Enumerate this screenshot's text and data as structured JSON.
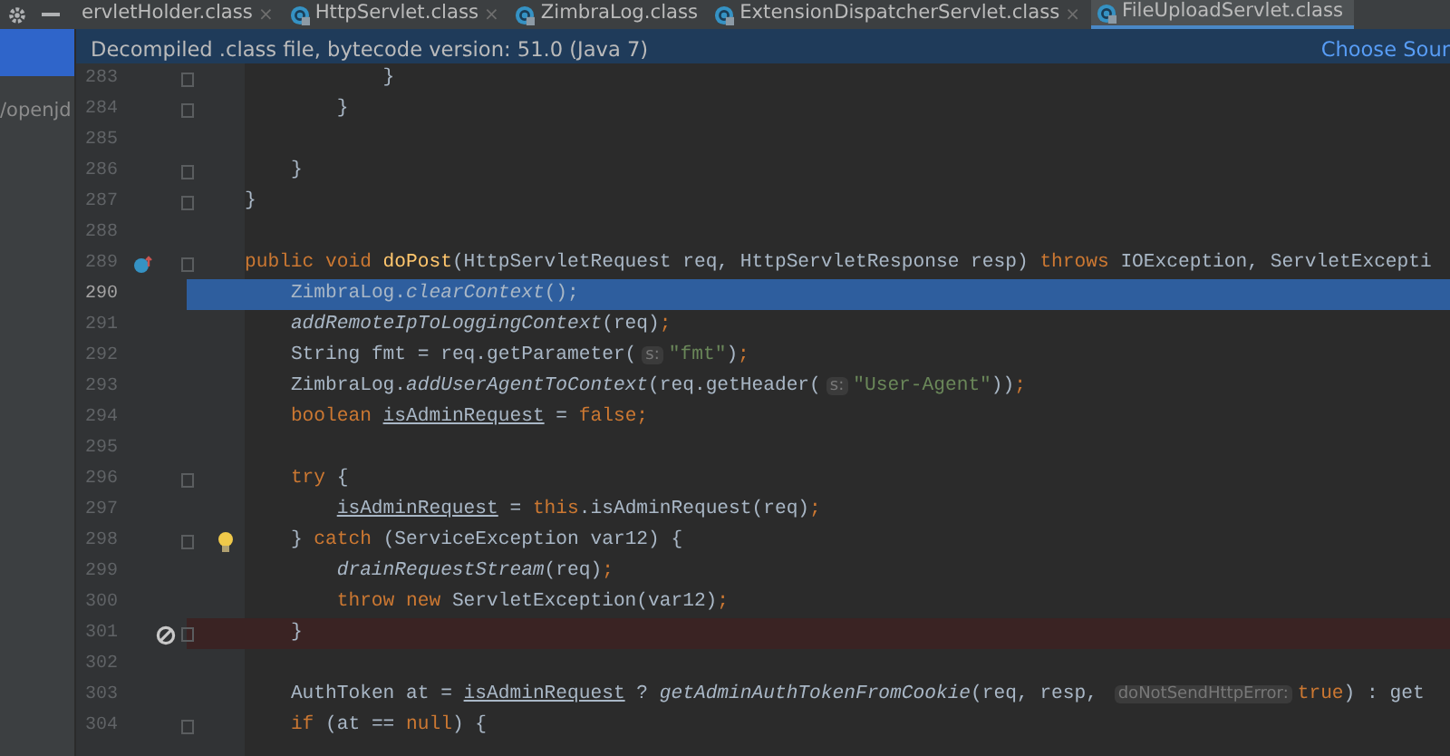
{
  "toolbar": {
    "sidebar_label": "/openjd"
  },
  "tabs": [
    {
      "label": "ervletHolder.class",
      "selected": false,
      "close": "×",
      "icon": false
    },
    {
      "label": "HttpServlet.class",
      "selected": false,
      "close": "×",
      "icon": true
    },
    {
      "label": "ZimbraLog.class",
      "selected": false,
      "icon": true
    },
    {
      "label": "ExtensionDispatcherServlet.class",
      "selected": false,
      "close": "×",
      "icon": true
    },
    {
      "label": "FileUploadServlet.class",
      "selected": true,
      "icon": true
    }
  ],
  "banner": {
    "message": "Decompiled .class file, bytecode version: 51.0 (Java 7)",
    "link": "Choose Sour"
  },
  "lines": [
    {
      "number": "283",
      "selected": false,
      "breakpoint": false,
      "foldable": true,
      "segments": [
        {
          "kind": "plain",
          "text": "            }"
        }
      ]
    },
    {
      "number": "284",
      "selected": false,
      "breakpoint": false,
      "foldable": true,
      "segments": [
        {
          "kind": "plain",
          "text": "        }"
        }
      ]
    },
    {
      "number": "285",
      "selected": false,
      "breakpoint": false,
      "foldable": false
    },
    {
      "number": "286",
      "selected": false,
      "breakpoint": false,
      "foldable": true,
      "segments": [
        {
          "kind": "plain",
          "text": "    }"
        }
      ]
    },
    {
      "number": "287",
      "selected": false,
      "breakpoint": false,
      "foldable": true,
      "segments": [
        {
          "kind": "plain",
          "text": "}"
        }
      ]
    },
    {
      "number": "288",
      "selected": false,
      "breakpoint": false,
      "foldable": false
    },
    {
      "number": "289",
      "selected": false,
      "breakpoint": false,
      "foldable": true,
      "gutter_icon": {
        "kind": "override"
      },
      "segments": [
        {
          "kind": "keyword",
          "text": "public void "
        },
        {
          "kind": "method",
          "text": "doPost"
        },
        {
          "kind": "plain",
          "text": "(HttpServletRequest req, HttpServletResponse resp) "
        },
        {
          "kind": "keyword",
          "text": "throws "
        },
        {
          "kind": "plain",
          "text": "IOException, ServletExcepti"
        }
      ]
    },
    {
      "number": "290",
      "selected": true,
      "breakpoint": false,
      "foldable": false,
      "segments": [
        {
          "kind": "plain",
          "text": "    ZimbraLog."
        },
        {
          "kind": "call",
          "text": "clearContext"
        },
        {
          "kind": "plain",
          "text": "();"
        }
      ]
    },
    {
      "number": "291",
      "selected": false,
      "breakpoint": false,
      "foldable": false,
      "segments": [
        {
          "kind": "call",
          "text": "    addRemoteIpToLoggingContext"
        },
        {
          "kind": "plain",
          "text": "(req)"
        },
        {
          "kind": "keyword",
          "text": ";"
        }
      ]
    },
    {
      "number": "292",
      "selected": false,
      "breakpoint": false,
      "foldable": false,
      "segments": [
        {
          "kind": "plain",
          "text": "    String fmt = req.getParameter("
        },
        {
          "kind": "hint",
          "text": "s:"
        },
        {
          "kind": "string",
          "text": "\"fmt\""
        },
        {
          "kind": "plain",
          "text": ")"
        },
        {
          "kind": "keyword",
          "text": ";"
        }
      ]
    },
    {
      "number": "293",
      "selected": false,
      "breakpoint": false,
      "foldable": false,
      "segments": [
        {
          "kind": "plain",
          "text": "    ZimbraLog."
        },
        {
          "kind": "call",
          "text": "addUserAgentToContext"
        },
        {
          "kind": "plain",
          "text": "(req.getHeader("
        },
        {
          "kind": "hint",
          "text": "s:"
        },
        {
          "kind": "string",
          "text": "\"User-Agent\""
        },
        {
          "kind": "plain",
          "text": "))"
        },
        {
          "kind": "keyword",
          "text": ";"
        }
      ]
    },
    {
      "number": "294",
      "selected": false,
      "breakpoint": false,
      "foldable": false,
      "segments": [
        {
          "kind": "keyword",
          "text": "    boolean "
        },
        {
          "kind": "var",
          "text": "isAdminRequest"
        },
        {
          "kind": "plain",
          "text": " = "
        },
        {
          "kind": "keyword",
          "text": "false;"
        }
      ]
    },
    {
      "number": "295",
      "selected": false,
      "breakpoint": false,
      "foldable": false
    },
    {
      "number": "296",
      "selected": false,
      "breakpoint": false,
      "foldable": true,
      "segments": [
        {
          "kind": "keyword",
          "text": "    try "
        },
        {
          "kind": "plain",
          "text": "{"
        }
      ]
    },
    {
      "number": "297",
      "selected": false,
      "breakpoint": false,
      "foldable": false,
      "segments": [
        {
          "kind": "var",
          "text": "        isAdminRequest"
        },
        {
          "kind": "plain",
          "text": " = "
        },
        {
          "kind": "keyword",
          "text": "this"
        },
        {
          "kind": "plain",
          "text": ".isAdminRequest(req)"
        },
        {
          "kind": "keyword",
          "text": ";"
        }
      ]
    },
    {
      "number": "298",
      "selected": false,
      "breakpoint": false,
      "foldable": true,
      "gutter_icon": {
        "kind": "bulb"
      },
      "segments": [
        {
          "kind": "plain",
          "text": "    } "
        },
        {
          "kind": "keyword",
          "text": "catch "
        },
        {
          "kind": "plain",
          "text": "(ServiceException var12) {"
        }
      ]
    },
    {
      "number": "299",
      "selected": false,
      "breakpoint": false,
      "foldable": false,
      "segments": [
        {
          "kind": "call",
          "text": "        drainRequestStream"
        },
        {
          "kind": "plain",
          "text": "(req)"
        },
        {
          "kind": "keyword",
          "text": ";"
        }
      ]
    },
    {
      "number": "300",
      "selected": false,
      "breakpoint": false,
      "foldable": false,
      "segments": [
        {
          "kind": "keyword",
          "text": "        throw new "
        },
        {
          "kind": "plain",
          "text": "ServletException(var12)"
        },
        {
          "kind": "keyword",
          "text": ";"
        }
      ]
    },
    {
      "number": "301",
      "selected": false,
      "breakpoint": true,
      "foldable": true,
      "gutter_icon": {
        "kind": "muted-breakpoint"
      },
      "segments": [
        {
          "kind": "plain",
          "text": "    }"
        }
      ]
    },
    {
      "number": "302",
      "selected": false,
      "breakpoint": false,
      "foldable": false
    },
    {
      "number": "303",
      "selected": false,
      "breakpoint": false,
      "foldable": false,
      "segments": [
        {
          "kind": "plain",
          "text": "    AuthToken at = "
        },
        {
          "kind": "var",
          "text": "isAdminRequest"
        },
        {
          "kind": "plain",
          "text": " ? "
        },
        {
          "kind": "call",
          "text": "getAdminAuthTokenFromCookie"
        },
        {
          "kind": "plain",
          "text": "(req, resp, "
        },
        {
          "kind": "hint",
          "text": "doNotSendHttpError:"
        },
        {
          "kind": "keyword",
          "text": "true"
        },
        {
          "kind": "plain",
          "text": ") : get"
        }
      ]
    },
    {
      "number": "304",
      "selected": false,
      "breakpoint": false,
      "foldable": true,
      "segments": [
        {
          "kind": "keyword",
          "text": "    if "
        },
        {
          "kind": "plain",
          "text": "(at == "
        },
        {
          "kind": "keyword",
          "text": "null"
        },
        {
          "kind": "plain",
          "text": ") {"
        }
      ]
    }
  ]
}
